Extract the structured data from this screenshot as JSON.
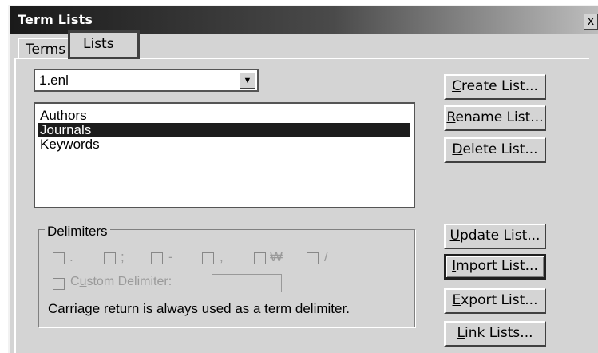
{
  "window": {
    "title": "Term Lists",
    "close_label": "x"
  },
  "tabs": [
    {
      "label": "Terms",
      "active": false
    },
    {
      "label": "Lists",
      "active": true
    }
  ],
  "library_select": {
    "value": "1.enl"
  },
  "term_lists": {
    "items": [
      "Authors",
      "Journals",
      "Keywords"
    ],
    "selected": "Journals"
  },
  "buttons": {
    "create": {
      "mnemonic": "C",
      "rest": "reate List..."
    },
    "rename": {
      "mnemonic": "R",
      "rest": "ename List..."
    },
    "delete": {
      "mnemonic": "D",
      "rest": "elete List..."
    },
    "update": {
      "mnemonic": "U",
      "rest": "pdate List..."
    },
    "import": {
      "mnemonic": "I",
      "rest": "mport List..."
    },
    "export": {
      "mnemonic": "E",
      "rest": "xport List..."
    },
    "link": {
      "mnemonic": "L",
      "rest": "ink Lists..."
    }
  },
  "delimiters": {
    "legend": "Delimiters",
    "symbols": [
      ".",
      ";",
      "-",
      ",",
      "₩",
      "/"
    ],
    "custom_prefix": "C",
    "custom_mnemonic": "u",
    "custom_rest": "stom Delimiter:",
    "note": "Carriage return is always used as a term delimiter."
  },
  "colors": {
    "selection": "#1c1c1c",
    "face": "#d4d4d4"
  }
}
